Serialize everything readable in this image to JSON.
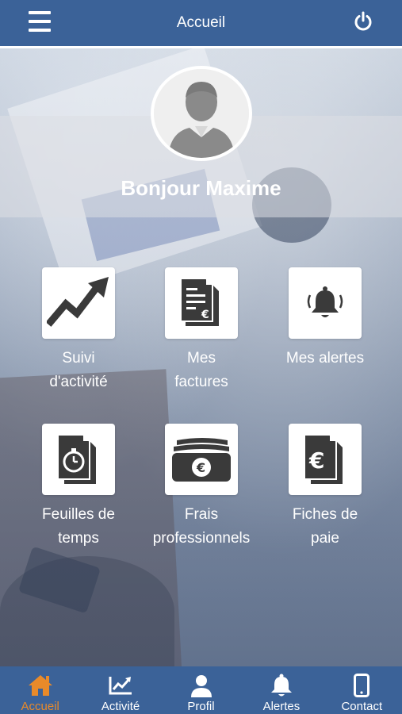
{
  "header": {
    "title": "Accueil",
    "menu_icon": "hamburger-menu-icon",
    "power_icon": "power-icon"
  },
  "profile": {
    "greeting": "Bonjour Maxime",
    "avatar_icon": "user-avatar-icon"
  },
  "tiles": [
    {
      "label_line1": "Suivi",
      "label_line2": "d'activité",
      "icon": "trending-up-icon"
    },
    {
      "label_line1": "Mes",
      "label_line2": "factures",
      "icon": "invoice-euro-icon"
    },
    {
      "label_line1": "Mes alertes",
      "label_line2": "",
      "icon": "bell-ringing-icon"
    },
    {
      "label_line1": "Feuilles de",
      "label_line2": "temps",
      "icon": "timesheet-stopwatch-icon"
    },
    {
      "label_line1": "Frais",
      "label_line2": "professionnels",
      "icon": "euro-banknotes-icon"
    },
    {
      "label_line1": "Fiches de",
      "label_line2": "paie",
      "icon": "payslip-euro-icon"
    }
  ],
  "bottom_nav": [
    {
      "label": "Accueil",
      "icon": "home-icon",
      "active": true
    },
    {
      "label": "Activité",
      "icon": "chart-icon",
      "active": false
    },
    {
      "label": "Profil",
      "icon": "person-icon",
      "active": false
    },
    {
      "label": "Alertes",
      "icon": "bell-icon",
      "active": false
    },
    {
      "label": "Contact",
      "icon": "smartphone-icon",
      "active": false
    }
  ],
  "colors": {
    "primary": "#3b6298",
    "active_nav": "#e88a2a",
    "icon_dark": "#3a3a3a",
    "white": "#ffffff"
  }
}
